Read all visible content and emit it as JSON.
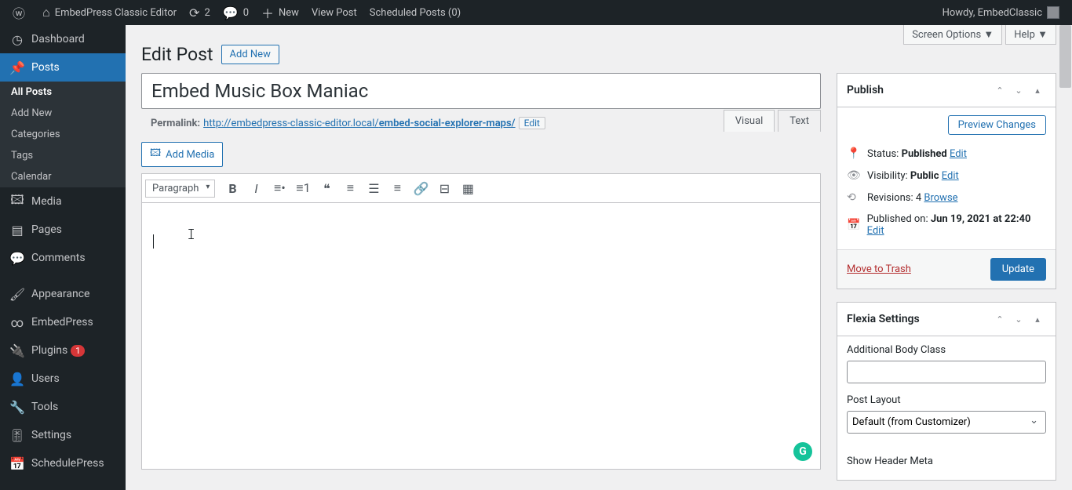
{
  "adminbar": {
    "site_name": "EmbedPress Classic Editor",
    "updates_count": "2",
    "comments_count": "0",
    "new_label": "New",
    "view_post": "View Post",
    "scheduled_posts": "Scheduled Posts (0)",
    "howdy": "Howdy, EmbedClassic"
  },
  "sidebar": {
    "dashboard": "Dashboard",
    "posts": "Posts",
    "all_posts": "All Posts",
    "add_new": "Add New",
    "categories": "Categories",
    "tags": "Tags",
    "calendar": "Calendar",
    "media": "Media",
    "pages": "Pages",
    "comments": "Comments",
    "appearance": "Appearance",
    "embedpress": "EmbedPress",
    "plugins": "Plugins",
    "plugins_badge": "1",
    "users": "Users",
    "tools": "Tools",
    "settings": "Settings",
    "schedulepress": "SchedulePress"
  },
  "screen_options": {
    "label": "Screen Options",
    "help": "Help"
  },
  "heading": {
    "title": "Edit Post",
    "add_new": "Add New"
  },
  "post": {
    "title": "Embed Music Box Maniac",
    "permalink_label": "Permalink:",
    "permalink_base": "http://embedpress-classic-editor.local/",
    "permalink_slug": "embed-social-explorer-maps/",
    "edit_btn": "Edit"
  },
  "editor": {
    "add_media": "Add Media",
    "visual_tab": "Visual",
    "text_tab": "Text",
    "format": "Paragraph"
  },
  "publish": {
    "title": "Publish",
    "preview": "Preview Changes",
    "status_label": "Status:",
    "status_value": "Published",
    "status_edit": "Edit",
    "visibility_label": "Visibility:",
    "visibility_value": "Public",
    "visibility_edit": "Edit",
    "revisions_label": "Revisions:",
    "revisions_value": "4",
    "revisions_browse": "Browse",
    "published_label": "Published on:",
    "published_value": "Jun 19, 2021 at 22:40",
    "published_edit": "Edit",
    "trash": "Move to Trash",
    "update": "Update"
  },
  "flexia": {
    "title": "Flexia Settings",
    "body_class_label": "Additional Body Class",
    "post_layout_label": "Post Layout",
    "post_layout_value": "Default (from Customizer)",
    "show_header_meta_label": "Show Header Meta"
  }
}
